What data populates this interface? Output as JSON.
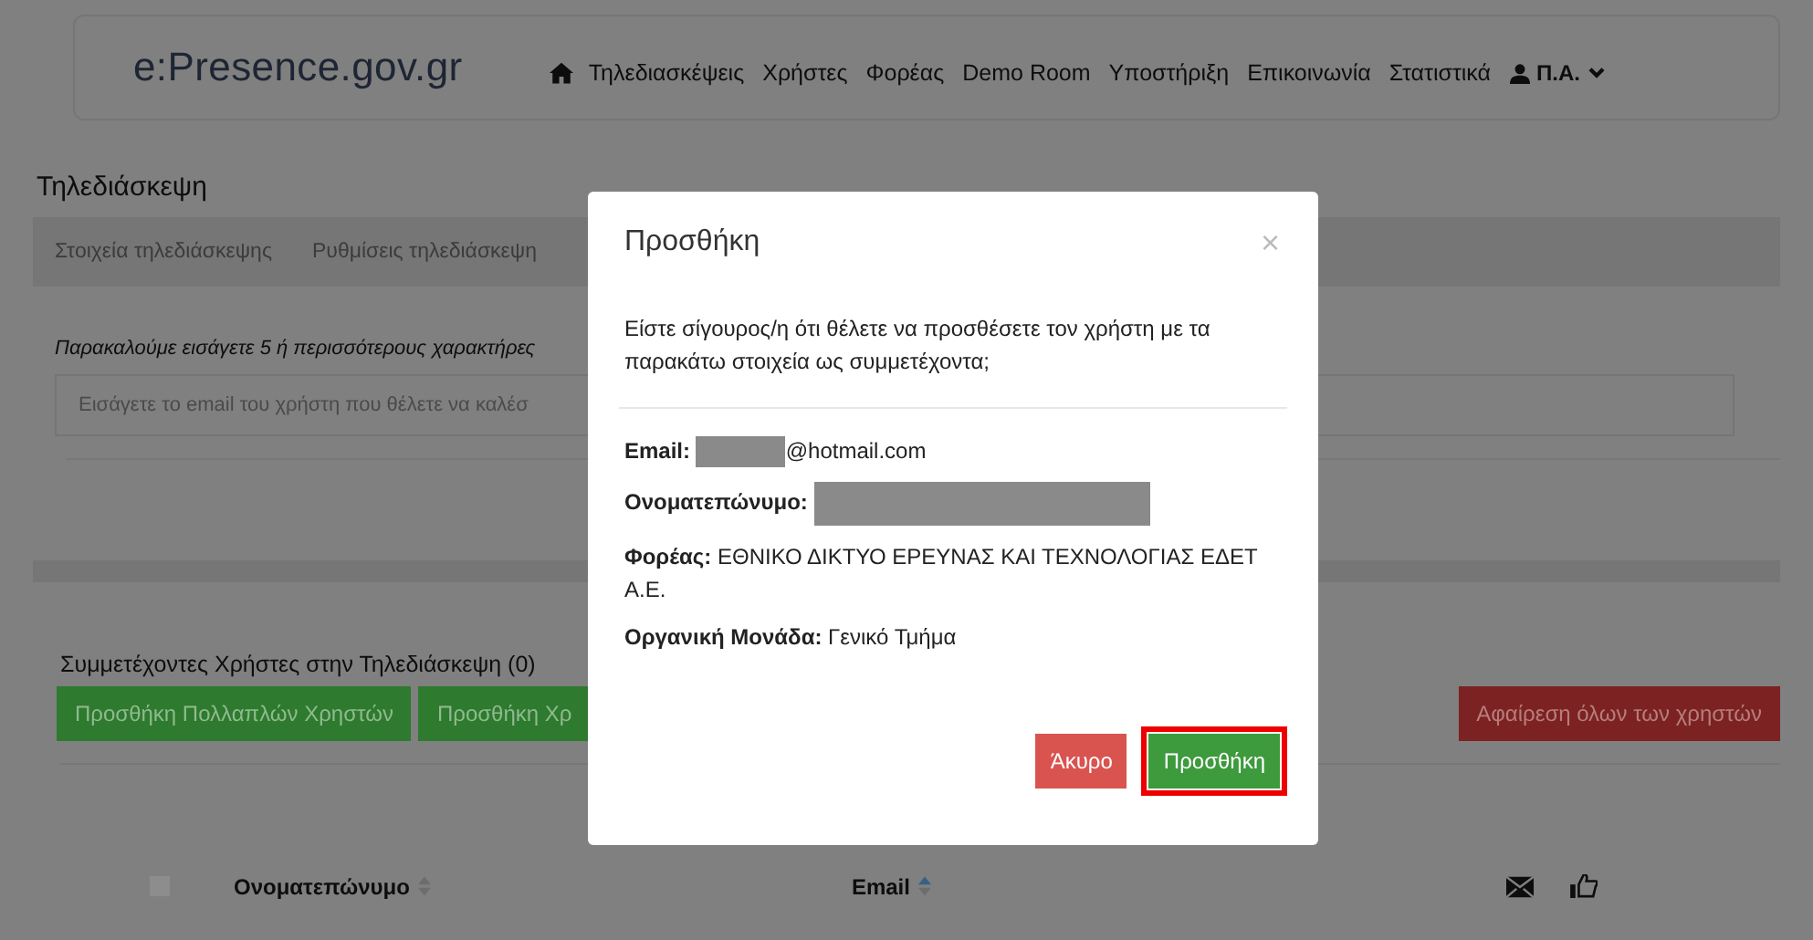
{
  "navbar": {
    "logo": "e:Presence.gov.gr",
    "links": [
      "Τηλεδιασκέψεις",
      "Χρήστες",
      "Φορέας",
      "Demo Room",
      "Υποστήριξη",
      "Επικοινωνία",
      "Στατιστικά"
    ],
    "user": "Π.Α."
  },
  "page": {
    "title": "Τηλεδιάσκεψη",
    "tabs": [
      "Στοιχεία τηλεδιάσκεψης",
      "Ρυθμίσεις τηλεδιάσκεψη"
    ],
    "instruction": "Παρακαλούμε εισάγετε 5 ή περισσότερους χαρακτήρες",
    "email_field": {
      "placeholder": "Εισάγετε το email του χρήστη που θέλετε να καλέσ"
    },
    "participants_heading": "Συμμετέχοντες Χρήστες στην Τηλεδιάσκεψη (0)",
    "buttons": [
      {
        "label": "Προσθήκη Πολλαπλών Χρηστών",
        "kind": "success"
      },
      {
        "label": "Προσθήκη Χρ",
        "kind": "success"
      }
    ],
    "remove_all_button": "Αφαίρεση όλων των χρηστών",
    "table": {
      "select_all_checked": false,
      "columns": [
        {
          "label": "Ονοματεπώνυμο",
          "sorted": false
        },
        {
          "label": "Email",
          "sorted": true
        }
      ]
    }
  },
  "modal": {
    "title": "Προσθήκη",
    "close": "×",
    "message": "Είστε σίγουρος/η ότι θέλετε να προσθέσετε τον χρήστη με τα παρακάτω στοιχεία ως συμμετέχοντα;",
    "fields": [
      {
        "label": "Email:",
        "value": "@hotmail.com",
        "redacted": true
      },
      {
        "label": "Ονοματεπώνυμο:",
        "redacted": true
      },
      {
        "label": "Φορέας:",
        "value": "ΕΘΝΙΚΟ ΔΙΚΤΥΟ ΕΡΕΥΝΑΣ ΚΑΙ ΤΕΧΝΟΛΟΓΙΑΣ ΕΔΕΤ Α.Ε.",
        "redacted": false
      },
      {
        "label": "Οργανική Μονάδα:",
        "value": "Γενικό Τμήμα",
        "redacted": false
      }
    ],
    "buttons": [
      {
        "label": "Άκυρο",
        "kind": "danger",
        "highlighted": false
      },
      {
        "label": "Προσθήκη",
        "kind": "success",
        "highlighted": true
      }
    ]
  }
}
